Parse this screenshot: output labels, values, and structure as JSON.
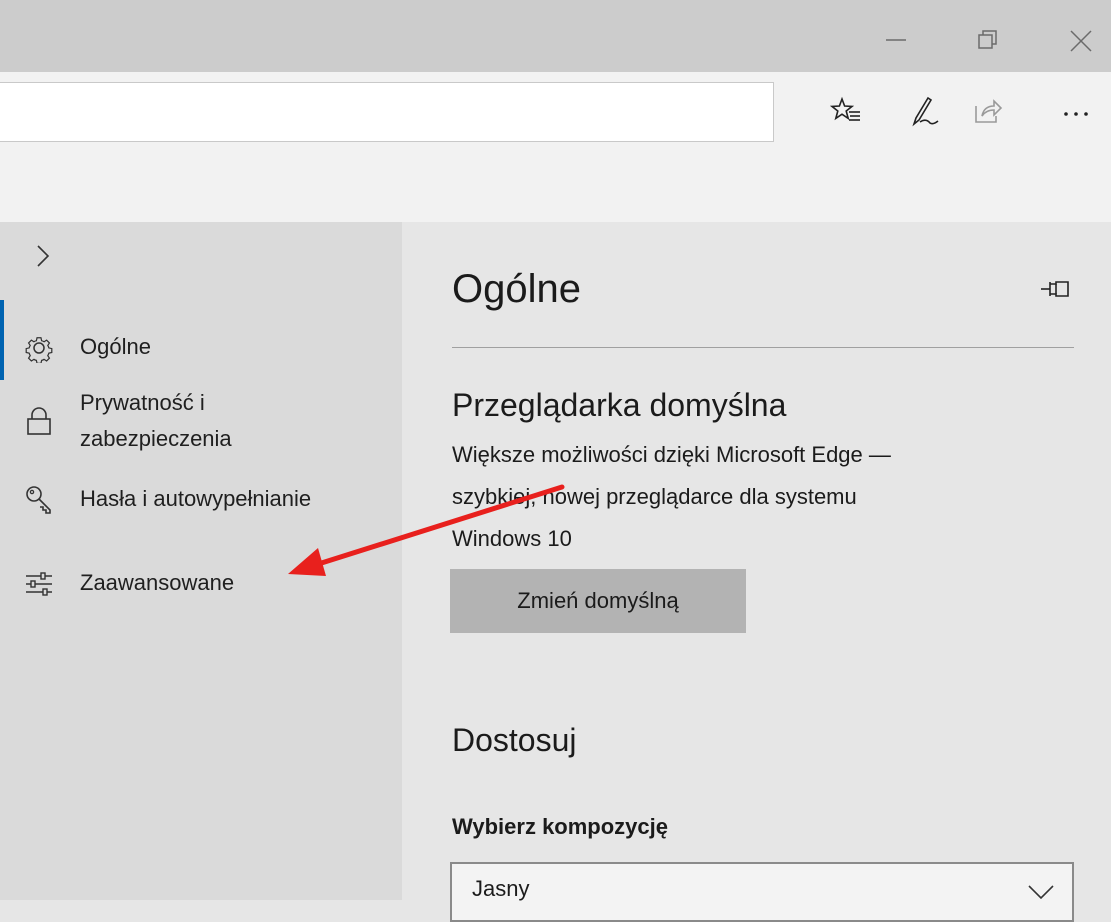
{
  "nav": {
    "items": [
      {
        "label": "Ogólne",
        "icon": "gear-icon"
      },
      {
        "label_line1": "Prywatność i",
        "label_line2": "zabezpieczenia",
        "icon": "lock-icon"
      },
      {
        "label": "Hasła i autowypełnianie",
        "icon": "key-icon"
      },
      {
        "label": "Zaawansowane",
        "icon": "sliders-icon"
      }
    ],
    "active_color": "#0063b1"
  },
  "settings": {
    "title": "Ogólne",
    "default_browser": {
      "title": "Przeglądarka domyślna",
      "desc_line1": "Większe możliwości dzięki Microsoft Edge —",
      "desc_line2": "szybkiej, nowej przeglądarce dla systemu",
      "desc_line3": "Windows 10",
      "button": "Zmień domyślną"
    },
    "customize": {
      "title": "Dostosuj",
      "theme_label": "Wybierz kompozycję",
      "theme_value": "Jasny"
    }
  },
  "annotation": {
    "type": "arrow",
    "color": "#e8201d"
  }
}
